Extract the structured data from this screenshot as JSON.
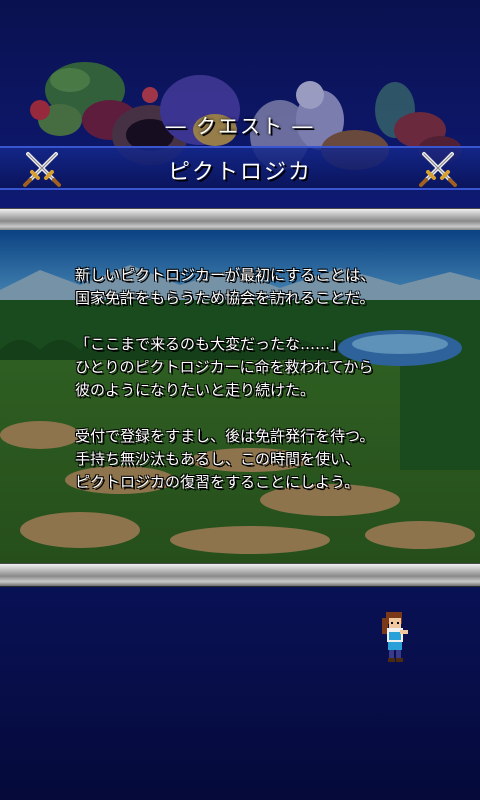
{
  "header": {
    "section_label": "― クエスト ―",
    "title": "ピクトロジカ"
  },
  "icons": {
    "left": "crossed-swords-icon",
    "right": "crossed-swords-icon"
  },
  "story": {
    "paragraph1": [
      "新しいピクトロジカーが最初にすることは、",
      "国家免許をもらうため協会を訪れることだ。"
    ],
    "paragraph2": [
      "「ここまで来るのも大変だったな……」",
      "ひとりのピクトロジカーに命を救われてから",
      "彼のようになりたいと走り続けた。"
    ],
    "paragraph3": [
      "受付で登録をすまし、後は免許発行を待つ。",
      "手持ち無沙汰もあるし、この時間を使い、",
      "ピクトロジカの復習をすることにしよう。"
    ]
  },
  "colors": {
    "background": "#0f1b78",
    "title_bar": "#14288c",
    "text": "#ffffff"
  }
}
